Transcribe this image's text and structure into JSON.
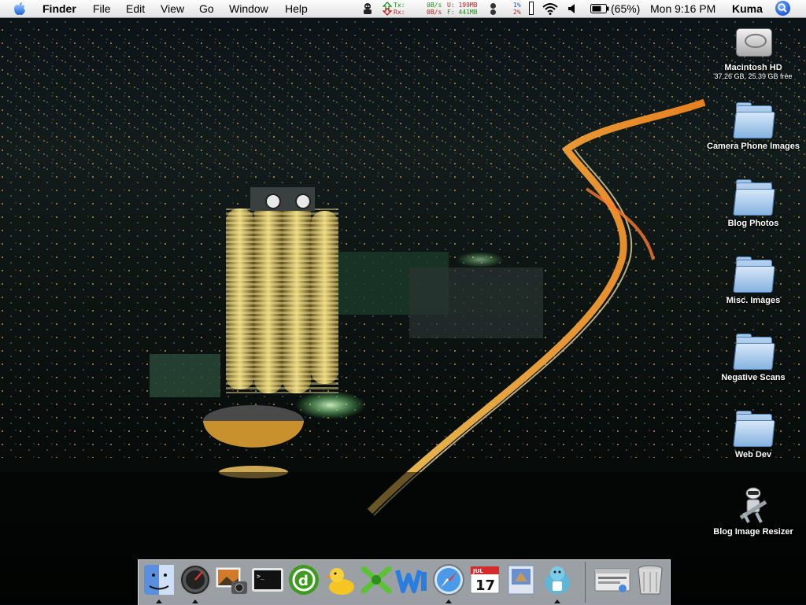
{
  "menubar": {
    "apple_icon": "apple-logo-icon",
    "app_name": "Finder",
    "menus": [
      "File",
      "Edit",
      "View",
      "Go",
      "Window",
      "Help"
    ],
    "net": {
      "tx_label": "Tx:",
      "rx_label": "Rx:",
      "tx_rate": "0B/s",
      "rx_rate": "0B/s"
    },
    "mem": {
      "used": "U: 199MB",
      "free": "F: 441MB"
    },
    "cpu": {
      "user": "1%",
      "system": "2%"
    },
    "battery": "(65%)",
    "clock": "Mon 9:16 PM",
    "user": "Kuma"
  },
  "desktop_icons": [
    {
      "label": "Macintosh HD",
      "sub": "37.26 GB, 25.39 GB free",
      "icon": "hard-drive-icon"
    },
    {
      "label": "Camera Phone Images",
      "icon": "folder-icon"
    },
    {
      "label": "Blog Photos",
      "icon": "folder-icon"
    },
    {
      "label": "Misc. Images",
      "icon": "folder-icon"
    },
    {
      "label": "Negative Scans",
      "icon": "folder-icon"
    },
    {
      "label": "Web Dev",
      "icon": "folder-icon"
    },
    {
      "label": "Blog Image Resizer",
      "icon": "automator-robot-icon"
    }
  ],
  "dock": {
    "apps": [
      "finder-icon",
      "dashboard-icon",
      "iphoto-icon",
      "terminal-icon",
      "dreamweaver-icon",
      "cyberduck-icon",
      "xcode-icon",
      "textwrangler-icon",
      "safari-icon",
      "ical-icon",
      "mail-icon",
      "adium-icon"
    ],
    "calendar_date": "17",
    "calendar_month": "JUL",
    "right": [
      "stickies-window-icon",
      "trash-icon"
    ]
  },
  "colors": {
    "menubar": "#f0f0f0",
    "folder": "#8cb8e6",
    "highway": "#ffb347"
  }
}
